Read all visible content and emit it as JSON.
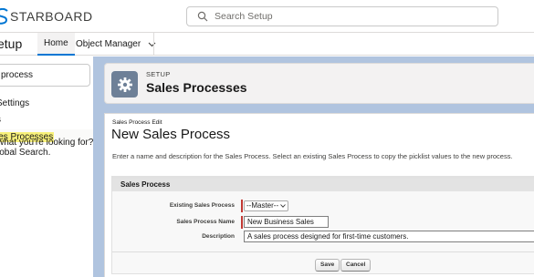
{
  "header": {
    "brand": "STARBOARD",
    "search_placeholder": "Search Setup"
  },
  "nav": {
    "app_name": "etup",
    "tabs": [
      {
        "label": "Home"
      },
      {
        "label": "Object Manager"
      }
    ]
  },
  "sidebar": {
    "quickfind_value": "process",
    "items": [
      {
        "label": "Settings"
      },
      {
        "label": "s"
      },
      {
        "label": "les Processes"
      }
    ],
    "help_lines": [
      "what you're looking for?",
      "lobal Search."
    ]
  },
  "setup_header": {
    "eyebrow": "SETUP",
    "title": "Sales Processes"
  },
  "page": {
    "eyebrow": "Sales Process Edit",
    "title": "New Sales Process",
    "description": "Enter a name and description for the Sales Process. Select an existing Sales Process to copy the picklist values to the new process."
  },
  "form": {
    "section_title": "Sales Process",
    "existing_label": "Existing Sales Process",
    "existing_value": "--Master--",
    "name_label": "Sales Process Name",
    "name_value": "New Business Sales",
    "description_label": "Description",
    "description_value": "A sales process designed for first-time customers.",
    "save_label": "Save",
    "cancel_label": "Cancel"
  },
  "colors": {
    "brand_blue": "#0176d3",
    "required_red": "#c23934",
    "setup_icon_bg": "#6e8097",
    "body_bg": "#b0c4df",
    "highlight": "#f8f17b"
  }
}
